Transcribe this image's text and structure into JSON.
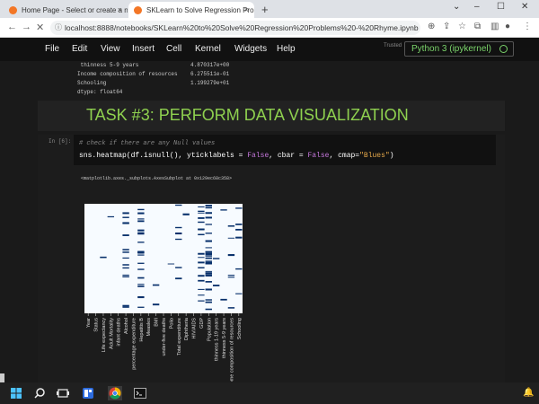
{
  "browser": {
    "tabs": [
      {
        "title": "Home Page - Select or create a n",
        "active": false
      },
      {
        "title": "SKLearn to Solve Regression Pro",
        "active": true
      }
    ],
    "url": "localhost:8888/notebooks/SKLearn%20to%20Solve%20Regression%20Problems%20-%20Rhyme.ipynb"
  },
  "jupyter": {
    "menu": [
      "File",
      "Edit",
      "View",
      "Insert",
      "Cell",
      "Kernel",
      "Widgets",
      "Help"
    ],
    "trusted": "Trusted",
    "kernel": "Python 3 (ipykernel)"
  },
  "notebook": {
    "prev_output": [
      " thinness 5-9 years                4.870317e+00",
      "Income composition of resources    6.275511e-01",
      "Schooling                          1.199279e+01",
      "dtype: float64"
    ],
    "section_title": "TASK #3: PERFORM DATA VISUALIZATION",
    "cell_prompt": "In [6]:",
    "code_comment": "# check if there are any Null values",
    "code_prefix": "sns.heatmap(df.isnull(), yticklabels = ",
    "code_false1": "False",
    "code_mid": ", cbar = ",
    "code_false2": "False",
    "code_mid2": ", cmap=",
    "code_string": "\"Blues\"",
    "code_suffix": ")",
    "output_repr": "<matplotlib.axes._subplots.AxesSubplot at 0x129ec68c358>"
  },
  "chart_data": {
    "type": "heatmap",
    "title": "",
    "columns": [
      "Year",
      "Status",
      "Life expectancy",
      "Adult Mortality",
      "infant deaths",
      "Alcohol",
      "percentage expenditure",
      "Hepatitis B",
      "Measles",
      "BMI",
      "under-five deaths",
      "Polio",
      "Total expenditure",
      "Diphtheria",
      "HIV/AIDS",
      "GDP",
      "Population",
      "thinness 1-19 years",
      "thinness 5-9 years",
      "Income composition of resources",
      "Schooling"
    ],
    "missing_density": [
      0,
      0,
      0.02,
      0.02,
      0,
      0.25,
      0,
      0.35,
      0,
      0.04,
      0,
      0.02,
      0.1,
      0.02,
      0,
      0.3,
      0.45,
      0.04,
      0.04,
      0.1,
      0.1
    ],
    "colormap": "Blues",
    "yticklabels": false,
    "cbar": false
  },
  "taskbar": {
    "icons": [
      "windows-icon",
      "search-icon",
      "taskview-icon",
      "widgets-icon",
      "chrome-icon",
      "terminal-icon"
    ]
  }
}
